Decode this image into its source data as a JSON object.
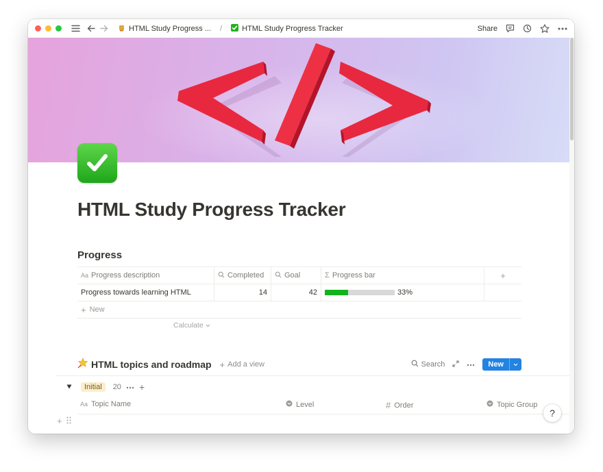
{
  "topbar": {
    "breadcrumb_parent": "HTML Study Progress ...",
    "breadcrumb_current": "HTML Study Progress Tracker",
    "share_label": "Share"
  },
  "page": {
    "title": "HTML Study Progress Tracker",
    "progress_heading": "Progress"
  },
  "progress_table": {
    "headers": {
      "description": "Progress description",
      "completed": "Completed",
      "goal": "Goal",
      "progress_bar": "Progress bar"
    },
    "row": {
      "description": "Progress towards learning HTML",
      "completed": "14",
      "goal": "42",
      "percent_label": "33%",
      "progress_fraction": 0.33
    },
    "new_label": "New",
    "calculate_label": "Calculate"
  },
  "database": {
    "title": "HTML topics and roadmap",
    "add_view_label": "Add a view",
    "search_label": "Search",
    "new_button_label": "New",
    "group": {
      "label": "Initial",
      "count": "20"
    },
    "columns": {
      "topic_name": "Topic Name",
      "level": "Level",
      "order": "Order",
      "topic_group": "Topic Group"
    }
  },
  "help_label": "?",
  "colors": {
    "accent_blue": "#2383e2",
    "progress_green": "#12b31a",
    "cover_red": "#e8283f",
    "badge_bg": "#fbeecb"
  }
}
